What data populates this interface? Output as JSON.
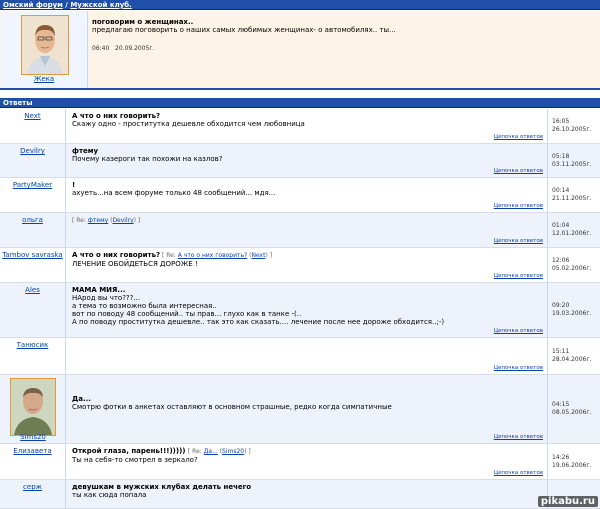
{
  "header": {
    "forum": "Омский форум",
    "sep": " / ",
    "section": "Мужской клуб."
  },
  "topic": {
    "user": "Жека",
    "title": "поговорим о женщинах..",
    "text": "предлагаю поговорить о наших самых любимых женщинах- о автомобилях.. ты...",
    "time": "06:40",
    "date": "20.09.2005г."
  },
  "replies_bar": {
    "title": "Ответы"
  },
  "thread_link": "Цепочка ответов",
  "replies": [
    {
      "user": "Next",
      "subject": "А что о них говорить?",
      "lines": [
        "Скажу одно - проститутка дешевле обходится чем любовница"
      ],
      "time": "16:05",
      "date": "26.10.2005г."
    },
    {
      "user": "Devilry",
      "subject": "фтему",
      "lines": [
        "Почему казероги так похожи на казлов?"
      ],
      "time": "05:18",
      "date": "03.11.2005г."
    },
    {
      "user": "PartyMaker",
      "subject": "!",
      "lines": [
        "ахуеть...на всем форуме только 48 сообщений... мдя..."
      ],
      "time": "00:14",
      "date": "21.11.2005г."
    },
    {
      "user": "ольга",
      "subject": "",
      "re_prefix": "[ Re: ",
      "re_link": "фтему",
      "re_by": "Devilry",
      "re_suffix": " ]",
      "lines": [],
      "time": "01:04",
      "date": "12.01.2006г."
    },
    {
      "user": "Tambov savraska",
      "subject": "А что о них говорить?",
      "re_prefix": "[ Re: ",
      "re_link": "А что о них говорить?",
      "re_by": "Next",
      "re_suffix": " ]",
      "lines": [
        "ЛЕЧЕНИЕ ОБОЙДЕТЬСЯ ДОРОЖЕ !"
      ],
      "time": "12:06",
      "date": "05.02.2006г."
    },
    {
      "user": "Ales",
      "subject": "МАМА МИЯ...",
      "lines": [
        "НАрод вы что???...",
        "а тема то возможно была интересная..",
        "вот по поводу 48 сообщений.. ты прав... глухо как в танке -(..",
        "А по поводу проститутка дешевле.. так это как сказать.... лечение после нее дороже обходится..;-)"
      ],
      "time": "09:20",
      "date": "19.03.2006г."
    },
    {
      "user": "Танюсик",
      "subject": "",
      "lines": [],
      "time": "15:11",
      "date": "28.04.2006г."
    },
    {
      "user": "Sims20",
      "subject": "Да...",
      "lines": [
        "Смотрю фотки в анкетах оставляют в основном страшные, редко когда симпатичные"
      ],
      "time": "04:15",
      "date": "08.05.2006г."
    },
    {
      "user": "Елизавета",
      "subject": "Открой глаза, парень!!!))))) ",
      "re_prefix": "[ Re: ",
      "re_link": "Да...",
      "re_by": "Sims20",
      "re_suffix": " ]",
      "lines": [
        "Ты на себя-то смотрел в зеркало?"
      ],
      "time": "14:26",
      "date": "19.06.2006г."
    },
    {
      "user": "серж",
      "subject": "девушкам в мужских клубах делать нечего",
      "lines": [
        "ты как сюда попала"
      ],
      "time": "",
      "date": ""
    }
  ],
  "watermark": "pikabu.ru",
  "colors": {
    "bar": "#1f4fa8",
    "row_alt": "#eef3fb",
    "topic_bg": "#fdf3e6",
    "link": "#0645ad"
  }
}
